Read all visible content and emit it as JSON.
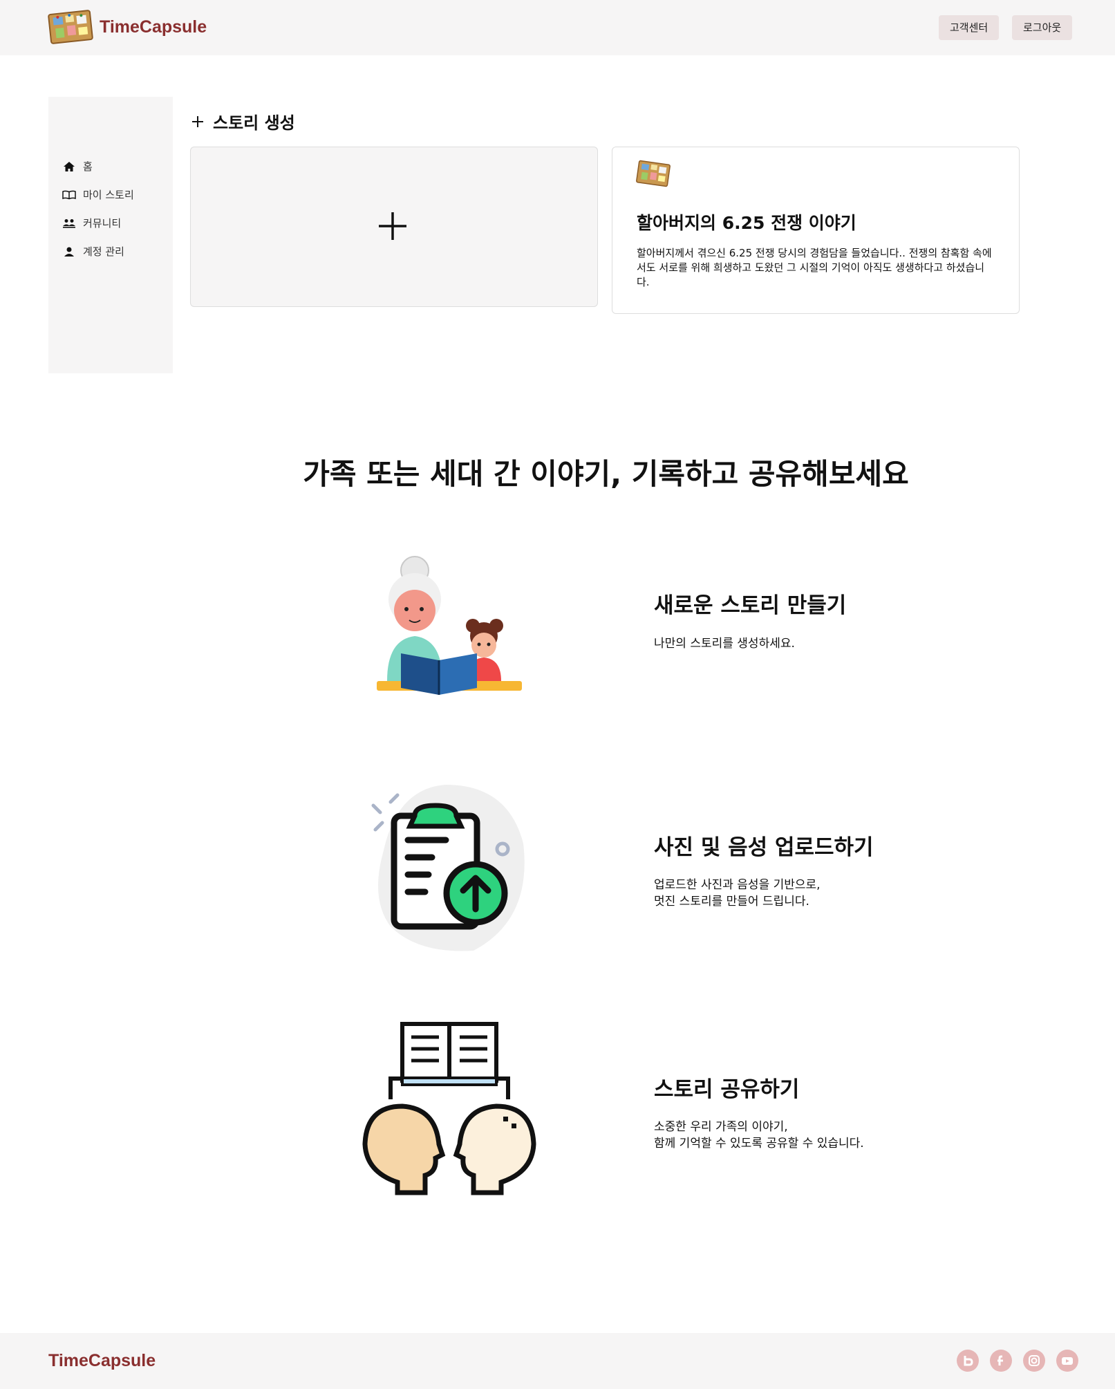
{
  "header": {
    "brand": "TimeCapsule",
    "support_label": "고객센터",
    "logout_label": "로그아웃"
  },
  "sidebar": {
    "items": [
      {
        "label": "홈",
        "icon": "home-icon"
      },
      {
        "label": "마이 스토리",
        "icon": "book-icon"
      },
      {
        "label": "커뮤니티",
        "icon": "community-icon"
      },
      {
        "label": "계정 관리",
        "icon": "user-icon"
      }
    ]
  },
  "main": {
    "create_title": "스토리 생성",
    "story_card": {
      "title": "할아버지의 6.25 전쟁 이야기",
      "description": "할아버지께서 겪으신 6.25 전쟁 당시의 경험담을 들었습니다.. 전쟁의 참혹함 속에서도 서로를 위해 희생하고 도왔던 그 시절의 기억이 아직도 생생하다고 하셨습니다."
    }
  },
  "headline": "가족 또는 세대 간 이야기, 기록하고 공유해보세요",
  "features": [
    {
      "title": "새로운 스토리 만들기",
      "desc": "나만의 스토리를 생성하세요."
    },
    {
      "title": "사진 및 음성 업로드하기",
      "desc": "업로드한 사진과 음성을 기반으로,\n멋진 스토리를 만들어 드립니다."
    },
    {
      "title": "스토리 공유하기",
      "desc": "소중한 우리 가족의 이야기,\n함께 기억할 수 있도록 공유할 수 있습니다."
    }
  ],
  "footer": {
    "brand": "TimeCapsule",
    "social": [
      "blog-icon",
      "facebook-icon",
      "instagram-icon",
      "youtube-icon"
    ]
  },
  "colors": {
    "brand": "#8a2f2f",
    "header_bg": "#f6f5f5",
    "button_bg": "#ebe1e1",
    "social_bg": "#e6b6b6"
  }
}
